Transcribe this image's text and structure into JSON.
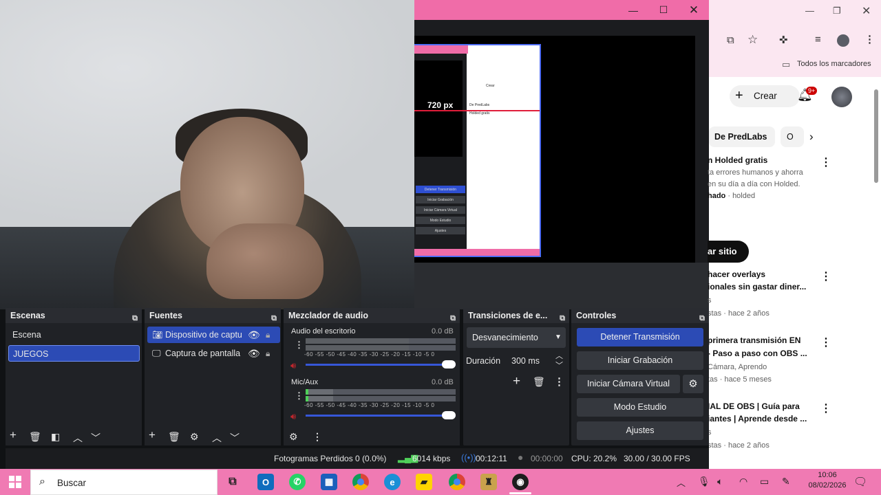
{
  "preview": {
    "nested_label": "720 px",
    "nested_lines": [
      "De PredLabs",
      "Holded gratis",
      "Crear",
      "Detener Transmisión",
      "Iniciar Grabación",
      "Iniciar Cámara Virtual",
      "Modo Estudio",
      "Ajustes"
    ]
  },
  "chrome": {
    "bookmarks_label": "Todos los marcadores",
    "create_label": "Crear",
    "notif_badge": "9+",
    "chips": [
      "De PredLabs",
      "O"
    ],
    "items": [
      {
        "title": "n Holded gratis",
        "line2": "ta errores humanos y ahorra",
        "line3": "en su día a día con Holded.",
        "meta_bold": "hado",
        "meta": "· holded"
      },
      {
        "title": "hacer overlays",
        "line2": "ionales sin gastar diner...",
        "line3": "s",
        "meta": "stas · hace 2 años"
      },
      {
        "title": "primera transmisión EN",
        "line2": "- Paso a paso con OBS ...",
        "line3": "Cámara, Aprendo",
        "meta": "tas · hace 5 meses"
      },
      {
        "title": "IAL DE OBS | Guía para",
        "line2": "iantes | Aprende desde ...",
        "line3": "s",
        "meta": "stas · hace 2 años"
      }
    ],
    "visit_button": "ar sitio"
  },
  "obs": {
    "scenes": {
      "title": "Escenas",
      "items": [
        "Escena",
        "JUEGOS"
      ]
    },
    "sources": {
      "title": "Fuentes",
      "items": [
        "Dispositivo de captu",
        "Captura de pantalla"
      ]
    },
    "mixer": {
      "title": "Mezclador de audio",
      "channels": [
        {
          "name": "Audio del escritorio",
          "db": "0.0 dB",
          "level": 0.0
        },
        {
          "name": "Mic/Aux",
          "db": "0.0 dB",
          "level": 0.03
        }
      ],
      "scale": [
        "-60",
        "-55",
        "-50",
        "-45",
        "-40",
        "-35",
        "-30",
        "-25",
        "-20",
        "-15",
        "-10",
        "-5",
        "0"
      ]
    },
    "transitions": {
      "title": "Transiciones de e...",
      "selected": "Desvanecimiento",
      "duration_label": "Duración",
      "duration_value": "300 ms"
    },
    "controls": {
      "title": "Controles",
      "buttons": [
        "Detener Transmisión",
        "Iniciar Grabación",
        "Iniciar Cámara Virtual",
        "Modo Estudio",
        "Ajustes"
      ]
    },
    "status": {
      "dropped": "Fotogramas Perdidos 0 (0.0%)",
      "bitrate": "6014 kbps",
      "stream_time": "00:12:11",
      "rec_time": "00:00:00",
      "cpu": "CPU: 20.2%",
      "fps": "30.00 / 30.00 FPS"
    }
  },
  "taskbar": {
    "search_placeholder": "Buscar",
    "time": "10:06",
    "date": "08/02/2026"
  }
}
